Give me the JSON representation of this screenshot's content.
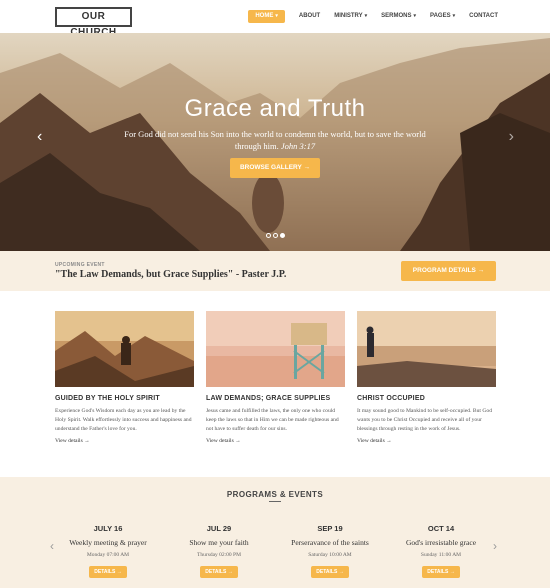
{
  "header": {
    "logo": "OUR CHURCH",
    "nav": [
      {
        "label": "HOME",
        "caret": "▾",
        "active": true
      },
      {
        "label": "ABOUT",
        "caret": ""
      },
      {
        "label": "MINISTRY",
        "caret": "▾"
      },
      {
        "label": "SERMONS",
        "caret": "▾"
      },
      {
        "label": "PAGES",
        "caret": "▾"
      },
      {
        "label": "CONTACT",
        "caret": ""
      }
    ]
  },
  "hero": {
    "title": "Grace and Truth",
    "subtitle": "For God did not send his Son into the world to condemn the world, but to save the world through him.",
    "reference": "John 3:17",
    "button": "BROWSE GALLERY →",
    "prev_icon": "‹",
    "next_icon": "›"
  },
  "upcoming": {
    "label": "UPCOMING EVENT",
    "title": "\"The Law Demands, but Grace Supplies\" - Paster J.P.",
    "button": "PROGRAM DETAILS →"
  },
  "cards": [
    {
      "title": "GUIDED BY THE HOLY SPIRIT",
      "text": "Experience God's Wisdom each day as you are lead by the Holy Spirit. Walk effortlessly into success and happiness and understand the Father's love for you.",
      "link": "View details →"
    },
    {
      "title": "LAW DEMANDS; GRACE SUPPLIES",
      "text": "Jesus came and fulfilled the laws, the only one who could keep the laws so that in Him we can be made righteous and not have to suffer death for our sins.",
      "link": "View details →"
    },
    {
      "title": "CHRIST OCCUPIED",
      "text": "It may sound good to Mankind to be self-occupied. But God wants you to be Christ Occupied and receive all of your blessings through resting in the work of Jesus.",
      "link": "View details →"
    }
  ],
  "programs": {
    "title": "PROGRAMS & EVENTS",
    "prev_icon": "‹",
    "next_icon": "›",
    "events": [
      {
        "date": "JULY 16",
        "name": "Weekly meeting & prayer",
        "time": "Monday 07:00 AM",
        "button": "DETAILS →"
      },
      {
        "date": "JUL 29",
        "name": "Show me your faith",
        "time": "Thursday 02:00 PM",
        "button": "DETAILS →"
      },
      {
        "date": "SEP 19",
        "name": "Perseravance of the saints",
        "time": "Saturday 10:00 AM",
        "button": "DETAILS →"
      },
      {
        "date": "OCT 14",
        "name": "God's irresistable grace",
        "time": "Sunday 11:00 AM",
        "button": "DETAILS →"
      }
    ]
  },
  "colors": {
    "accent": "#f6b74b",
    "band": "#f8efe2"
  }
}
